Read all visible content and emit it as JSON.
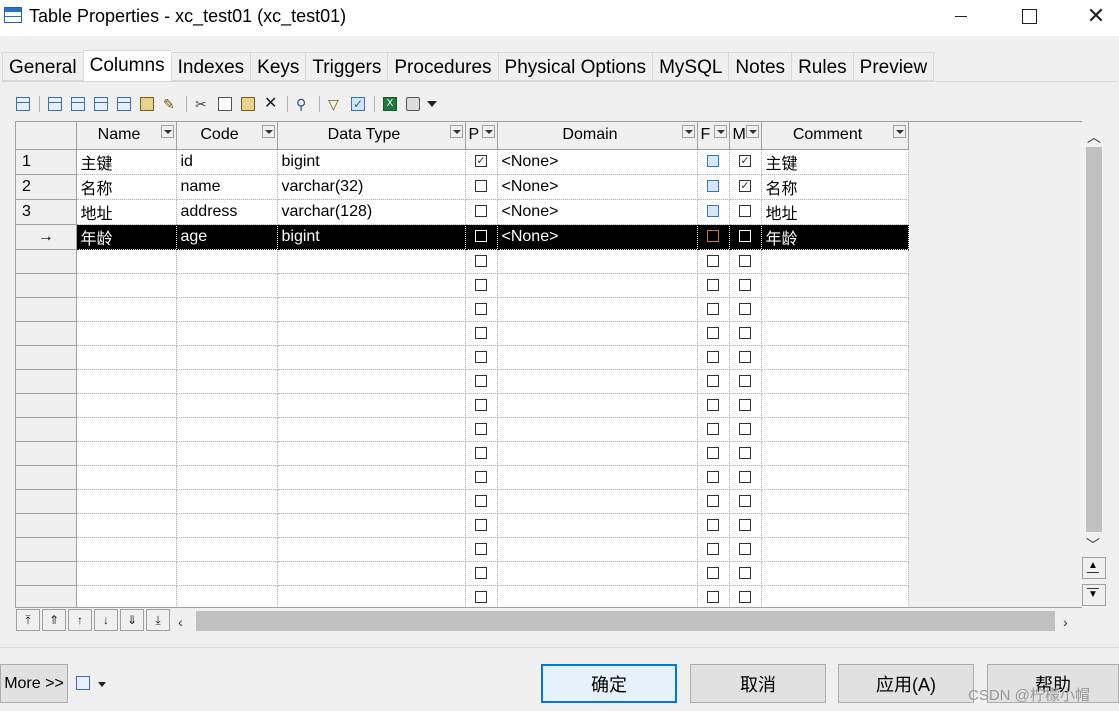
{
  "window": {
    "title": "Table Properties - xc_test01 (xc_test01)",
    "min_symbol": "",
    "close_symbol": "✕"
  },
  "tabs": [
    {
      "label": "General",
      "active": false
    },
    {
      "label": "Columns",
      "active": true
    },
    {
      "label": "Indexes",
      "active": false
    },
    {
      "label": "Keys",
      "active": false
    },
    {
      "label": "Triggers",
      "active": false
    },
    {
      "label": "Procedures",
      "active": false
    },
    {
      "label": "Physical Options",
      "active": false
    },
    {
      "label": "MySQL",
      "active": false
    },
    {
      "label": "Notes",
      "active": false
    },
    {
      "label": "Rules",
      "active": false
    },
    {
      "label": "Preview",
      "active": false
    }
  ],
  "toolbar": {
    "icons": [
      "properties-icon",
      "insert-row-icon",
      "add-row-icon",
      "add-rows-icon",
      "add-columns-icon",
      "paste-columns-icon",
      "new-icon",
      "cut-icon",
      "copy-icon",
      "paste-icon",
      "delete-icon",
      "find-icon",
      "filter-icon",
      "customize-columns-icon",
      "excel-export-icon",
      "print-icon",
      "dropdown-icon"
    ]
  },
  "grid": {
    "headers": {
      "name": "Name",
      "code": "Code",
      "data_type": "Data Type",
      "p": "P",
      "domain": "Domain",
      "f": "F",
      "m": "M",
      "comment": "Comment"
    },
    "rows": [
      {
        "num": "1",
        "name": "主键",
        "code": "id",
        "data_type": "bigint",
        "p": true,
        "domain": "<None>",
        "f": false,
        "m": true,
        "comment": "主键",
        "selected": false
      },
      {
        "num": "2",
        "name": "名称",
        "code": "name",
        "data_type": "varchar(32)",
        "p": false,
        "domain": "<None>",
        "f": false,
        "m": true,
        "comment": "名称",
        "selected": false
      },
      {
        "num": "3",
        "name": "地址",
        "code": "address",
        "data_type": "varchar(128)",
        "p": false,
        "domain": "<None>",
        "f": false,
        "m": false,
        "comment": "地址",
        "selected": false
      },
      {
        "num": "→",
        "name": "年龄",
        "code": "age",
        "data_type": "bigint",
        "p": false,
        "domain": "<None>",
        "f": false,
        "m": false,
        "comment": "年龄",
        "selected": true
      }
    ],
    "empty_rows": 15
  },
  "nav_buttons": [
    "⤒",
    "⇑",
    "↑",
    "↓",
    "⇓",
    "⤓"
  ],
  "footer": {
    "more_label": "More >>",
    "ok_label": "确定",
    "cancel_label": "取消",
    "apply_label": "应用(A)",
    "help_label": "帮助",
    "watermark": "CSDN @柠檬小帽"
  },
  "colors": {
    "selected_row_bg": "#000000",
    "default_button_border": "#0078d7",
    "f_checkbox_fill": "#d5e8fb"
  }
}
